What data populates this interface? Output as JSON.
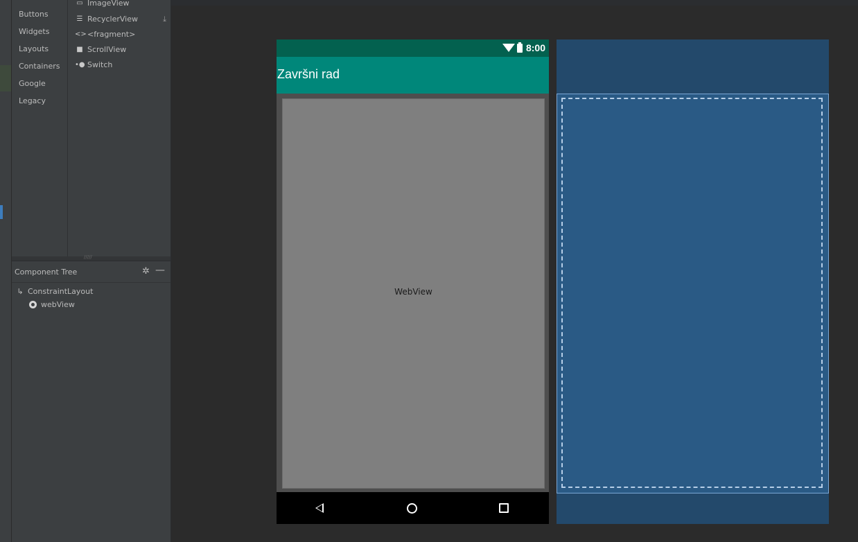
{
  "palette": {
    "categories": [
      "Buttons",
      "Widgets",
      "Layouts",
      "Containers",
      "Google",
      "Legacy"
    ],
    "widgets": [
      {
        "label": "ImageView",
        "icon": "image-icon"
      },
      {
        "label": "RecyclerView",
        "icon": "list-icon"
      },
      {
        "label": "<fragment>",
        "icon": "code-brackets-icon"
      },
      {
        "label": "ScrollView",
        "icon": "scrollview-icon"
      },
      {
        "label": "Switch",
        "icon": "switch-icon"
      }
    ]
  },
  "component_tree": {
    "title": "Component Tree",
    "items": [
      {
        "label": "ConstraintLayout",
        "icon": "constraint-layout-icon"
      },
      {
        "label": "webView",
        "icon": "webview-globe-icon"
      }
    ]
  },
  "device": {
    "status_time": "8:00",
    "app_title": "Završni rad",
    "webview_label": "WebView"
  },
  "colors": {
    "status_bar": "#03614f",
    "app_bar": "#00877a",
    "webview": "#7f7f7f",
    "blueprint": "#2a5a85"
  }
}
